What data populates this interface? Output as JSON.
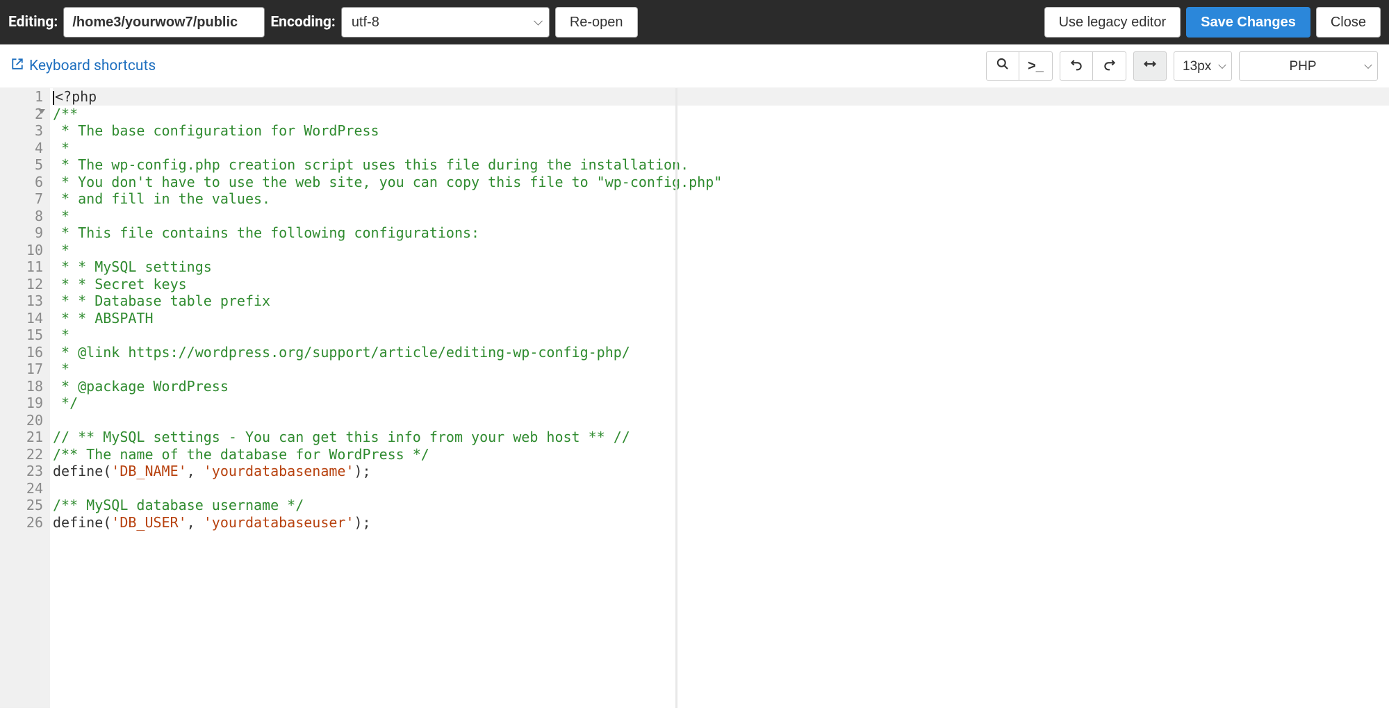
{
  "topbar": {
    "editing_label": "Editing:",
    "path_value": "/home3/yourwow7/public",
    "encoding_label": "Encoding:",
    "encoding_value": "utf-8",
    "reopen_label": "Re-open",
    "legacy_label": "Use legacy editor",
    "save_label": "Save Changes",
    "close_label": "Close"
  },
  "toolbar2": {
    "keyboard_shortcuts": "Keyboard shortcuts",
    "font_size": "13px",
    "language": "PHP"
  },
  "gutter": [
    "1",
    "2",
    "3",
    "4",
    "5",
    "6",
    "7",
    "8",
    "9",
    "10",
    "11",
    "12",
    "13",
    "14",
    "15",
    "16",
    "17",
    "18",
    "19",
    "20",
    "21",
    "22",
    "23",
    "24",
    "25",
    "26"
  ],
  "code": {
    "lines": [
      {
        "type": "active",
        "segments": [
          {
            "cls": "plain cursor-before",
            "text": "<?php"
          }
        ]
      },
      {
        "segments": [
          {
            "cls": "comment",
            "text": "/**"
          }
        ]
      },
      {
        "segments": [
          {
            "cls": "comment",
            "text": " * The base configuration for WordPress"
          }
        ]
      },
      {
        "segments": [
          {
            "cls": "comment",
            "text": " *"
          }
        ]
      },
      {
        "segments": [
          {
            "cls": "comment",
            "text": " * The wp-config.php creation script uses this file during the installation."
          }
        ]
      },
      {
        "segments": [
          {
            "cls": "comment",
            "text": " * You don't have to use the web site, you can copy this file to \"wp-config.php\""
          }
        ]
      },
      {
        "segments": [
          {
            "cls": "comment",
            "text": " * and fill in the values."
          }
        ]
      },
      {
        "segments": [
          {
            "cls": "comment",
            "text": " *"
          }
        ]
      },
      {
        "segments": [
          {
            "cls": "comment",
            "text": " * This file contains the following configurations:"
          }
        ]
      },
      {
        "segments": [
          {
            "cls": "comment",
            "text": " *"
          }
        ]
      },
      {
        "segments": [
          {
            "cls": "comment",
            "text": " * * MySQL settings"
          }
        ]
      },
      {
        "segments": [
          {
            "cls": "comment",
            "text": " * * Secret keys"
          }
        ]
      },
      {
        "segments": [
          {
            "cls": "comment",
            "text": " * * Database table prefix"
          }
        ]
      },
      {
        "segments": [
          {
            "cls": "comment",
            "text": " * * ABSPATH"
          }
        ]
      },
      {
        "segments": [
          {
            "cls": "comment",
            "text": " *"
          }
        ]
      },
      {
        "segments": [
          {
            "cls": "comment",
            "text": " * @link https://wordpress.org/support/article/editing-wp-config-php/"
          }
        ]
      },
      {
        "segments": [
          {
            "cls": "comment",
            "text": " *"
          }
        ]
      },
      {
        "segments": [
          {
            "cls": "comment",
            "text": " * @package WordPress"
          }
        ]
      },
      {
        "segments": [
          {
            "cls": "comment",
            "text": " */"
          }
        ]
      },
      {
        "segments": [
          {
            "cls": "plain",
            "text": ""
          }
        ]
      },
      {
        "segments": [
          {
            "cls": "comment",
            "text": "// ** MySQL settings - You can get this info from your web host ** //"
          }
        ]
      },
      {
        "segments": [
          {
            "cls": "comment",
            "text": "/** The name of the database for WordPress */"
          }
        ]
      },
      {
        "segments": [
          {
            "cls": "plain",
            "text": "define("
          },
          {
            "cls": "string",
            "text": "'DB_NAME'"
          },
          {
            "cls": "plain",
            "text": ", "
          },
          {
            "cls": "string",
            "text": "'yourdatabasename'"
          },
          {
            "cls": "plain",
            "text": ");"
          }
        ]
      },
      {
        "segments": [
          {
            "cls": "plain",
            "text": ""
          }
        ]
      },
      {
        "segments": [
          {
            "cls": "comment",
            "text": "/** MySQL database username */"
          }
        ]
      },
      {
        "segments": [
          {
            "cls": "plain",
            "text": "define("
          },
          {
            "cls": "string",
            "text": "'DB_USER'"
          },
          {
            "cls": "plain",
            "text": ", "
          },
          {
            "cls": "string",
            "text": "'yourdatabaseuser'"
          },
          {
            "cls": "plain",
            "text": ");"
          }
        ]
      }
    ]
  }
}
